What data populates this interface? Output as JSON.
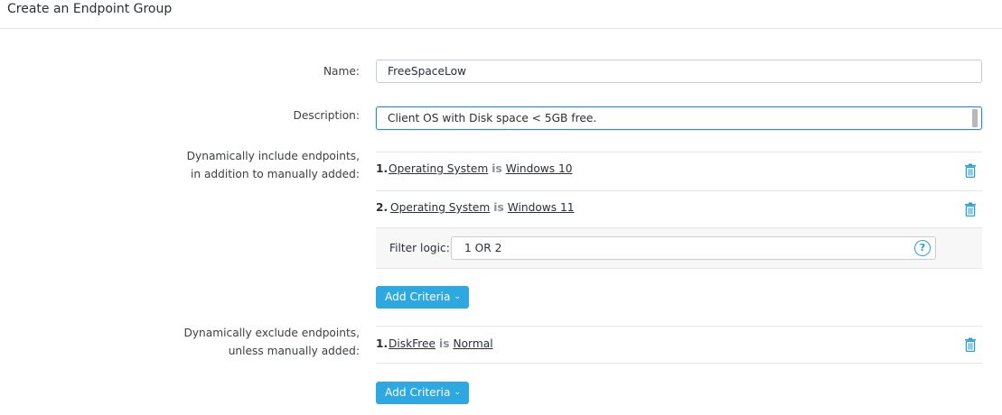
{
  "header": {
    "title": "Create an Endpoint Group"
  },
  "form": {
    "name_label": "Name:",
    "name_value": "FreeSpaceLow",
    "description_label": "Description:",
    "description_value": "Client OS with Disk space < 5GB free.",
    "include_label_line1": "Dynamically include endpoints,",
    "include_label_line2": "in addition to manually added:",
    "exclude_label_line1": "Dynamically exclude endpoints,",
    "exclude_label_line2": "unless manually added:"
  },
  "include_criteria": [
    {
      "num": "1.",
      "field": "Operating System",
      "op": "is",
      "value": "Windows 10"
    },
    {
      "num": "2.",
      "field": "Operating System",
      "op": "is",
      "value": "Windows 11"
    }
  ],
  "filter": {
    "label": "Filter logic:",
    "value": "1 OR 2",
    "help_glyph": "?"
  },
  "exclude_criteria": [
    {
      "num": "1.",
      "field": "DiskFree",
      "op": "is",
      "value": "Normal"
    }
  ],
  "buttons": {
    "add_criteria_label": "Add Criteria",
    "chevron_glyph": "⌄"
  },
  "icons": {
    "delete": "trash-icon",
    "help": "help-circle-icon",
    "dropdown": "chevron-down-icon"
  },
  "colors": {
    "accent": "#2ea8e0",
    "trash": "#2a9fd6"
  }
}
